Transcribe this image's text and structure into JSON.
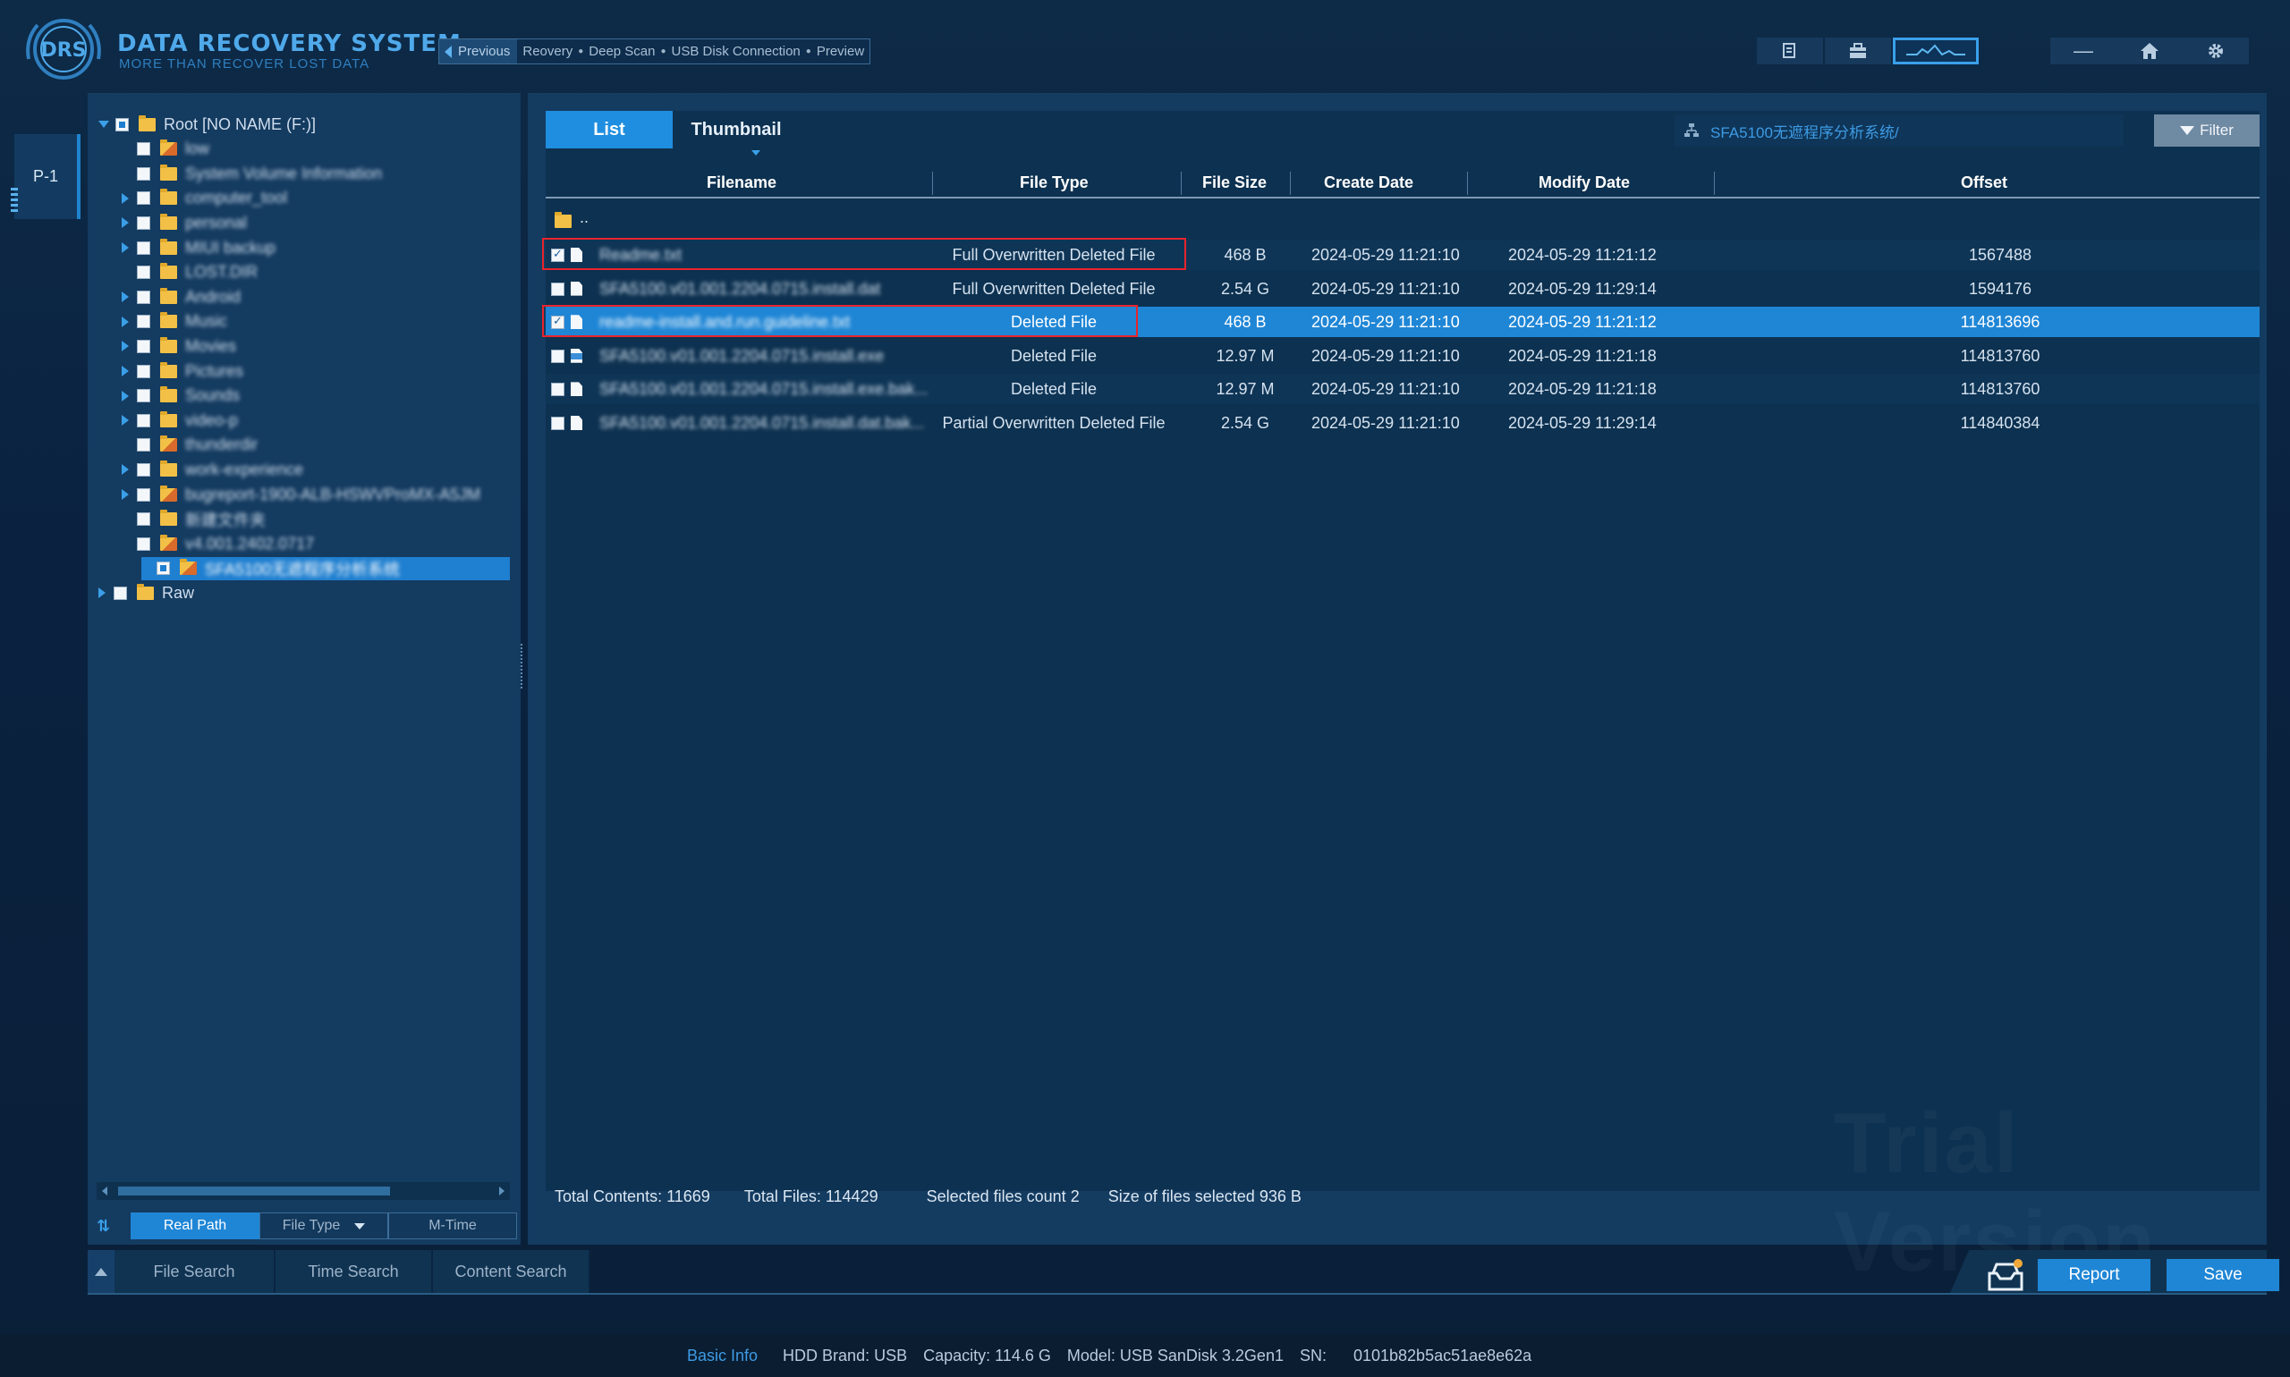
{
  "app": {
    "logo_mark": "DRS",
    "title": "DATA RECOVERY SYSTEM",
    "subtitle": "MORE THAN RECOVER LOST DATA"
  },
  "breadcrumb": {
    "previous_label": "Previous",
    "steps": [
      "Reovery",
      "Deep Scan",
      "USB Disk Connection",
      "Preview"
    ],
    "separator": "●"
  },
  "header_tools": {
    "icons": [
      "report-doc-icon",
      "briefcase-icon",
      "waveform-icon",
      "minimize-icon",
      "home-icon",
      "settings-gear-icon"
    ],
    "minimize_glyph": "—"
  },
  "partition_tab": {
    "label": "P-1"
  },
  "tree": {
    "items": [
      {
        "label": "Root [NO NAME    (F:)]",
        "level": 0,
        "expand": "open",
        "check": "partial",
        "blur": false,
        "special": false
      },
      {
        "label": "low",
        "level": 1,
        "expand": "none",
        "check": "none",
        "blur": true,
        "special": true
      },
      {
        "label": "System Volume Information",
        "level": 1,
        "expand": "none",
        "check": "none",
        "blur": true,
        "special": false
      },
      {
        "label": "computer_tool",
        "level": 1,
        "expand": "closed",
        "check": "none",
        "blur": true,
        "special": false
      },
      {
        "label": "personal",
        "level": 1,
        "expand": "closed",
        "check": "none",
        "blur": true,
        "special": false
      },
      {
        "label": "MIUI backup",
        "level": 1,
        "expand": "closed",
        "check": "none",
        "blur": true,
        "special": false
      },
      {
        "label": "LOST.DIR",
        "level": 1,
        "expand": "none",
        "check": "none",
        "blur": true,
        "special": false
      },
      {
        "label": "Android",
        "level": 1,
        "expand": "closed",
        "check": "none",
        "blur": true,
        "special": false
      },
      {
        "label": "Music",
        "level": 1,
        "expand": "closed",
        "check": "none",
        "blur": true,
        "special": false
      },
      {
        "label": "Movies",
        "level": 1,
        "expand": "closed",
        "check": "none",
        "blur": true,
        "special": false
      },
      {
        "label": "Pictures",
        "level": 1,
        "expand": "closed",
        "check": "none",
        "blur": true,
        "special": false
      },
      {
        "label": "Sounds",
        "level": 1,
        "expand": "closed",
        "check": "none",
        "blur": true,
        "special": false
      },
      {
        "label": "video-p",
        "level": 1,
        "expand": "closed",
        "check": "none",
        "blur": true,
        "special": false
      },
      {
        "label": "thunderdir",
        "level": 1,
        "expand": "none",
        "check": "none",
        "blur": true,
        "special": true
      },
      {
        "label": "work-experience",
        "level": 1,
        "expand": "closed",
        "check": "none",
        "blur": true,
        "special": false
      },
      {
        "label": "bugreport-1900-ALB-HSWVProMX-A5JM",
        "level": 1,
        "expand": "closed",
        "check": "none",
        "blur": true,
        "special": true
      },
      {
        "label": "新建文件夹",
        "level": 1,
        "expand": "none",
        "check": "none",
        "blur": true,
        "special": false
      },
      {
        "label": "v4.001.2402.0717",
        "level": 1,
        "expand": "none",
        "check": "none",
        "blur": true,
        "special": true
      },
      {
        "label": "SFA5100无遮程序分析系统",
        "level": 1,
        "expand": "none",
        "check": "partial",
        "blur": true,
        "special": true,
        "selected": true
      },
      {
        "label": "Raw",
        "level": 0,
        "expand": "closed",
        "check": "none",
        "blur": false,
        "special": false
      }
    ]
  },
  "tree_sort": {
    "buttons": [
      "Real Path",
      "File Type",
      "M-Time"
    ],
    "active": "Real Path"
  },
  "main": {
    "tabs": [
      "List",
      "Thumbnail"
    ],
    "active_tab": "List",
    "path": "SFA5100无遮程序分析系统/",
    "filter_label": "Filter",
    "columns": [
      "Filename",
      "File Type",
      "File Size",
      "Create Date",
      "Modify Date",
      "Offset"
    ],
    "parent_dir": "..",
    "rows": [
      {
        "checked": true,
        "highlight": true,
        "selected": false,
        "icon": "file",
        "name": "Readme.txt",
        "type": "Full Overwritten Deleted File",
        "size": "468 B",
        "created": "2024-05-29 11:21:10",
        "modified": "2024-05-29 11:21:12",
        "offset": "1567488"
      },
      {
        "checked": false,
        "highlight": false,
        "selected": false,
        "icon": "file",
        "name": "SFA5100.v01.001.2204.0715.install.dat",
        "type": "Full Overwritten Deleted File",
        "size": "2.54 G",
        "created": "2024-05-29 11:21:10",
        "modified": "2024-05-29 11:29:14",
        "offset": "1594176"
      },
      {
        "checked": true,
        "highlight": true,
        "selected": true,
        "icon": "file",
        "name": "readme-install.and.run.guideline.txt",
        "type": "Deleted File",
        "size": "468 B",
        "created": "2024-05-29 11:21:10",
        "modified": "2024-05-29 11:21:12",
        "offset": "114813696"
      },
      {
        "checked": false,
        "highlight": false,
        "selected": false,
        "icon": "exe",
        "name": "SFA5100.v01.001.2204.0715.install.exe",
        "type": "Deleted File",
        "size": "12.97 M",
        "created": "2024-05-29 11:21:10",
        "modified": "2024-05-29 11:21:18",
        "offset": "114813760"
      },
      {
        "checked": false,
        "highlight": false,
        "selected": false,
        "icon": "file",
        "name": "SFA5100.v01.001.2204.0715.install.exe.bak...",
        "type": "Deleted File",
        "size": "12.97 M",
        "created": "2024-05-29 11:21:10",
        "modified": "2024-05-29 11:21:18",
        "offset": "114813760"
      },
      {
        "checked": false,
        "highlight": false,
        "selected": false,
        "icon": "file",
        "name": "SFA5100.v01.001.2204.0715.install.dat.bak...",
        "type": "Partial Overwritten Deleted File",
        "size": "2.54 G",
        "created": "2024-05-29 11:21:10",
        "modified": "2024-05-29 11:29:14",
        "offset": "114840384"
      }
    ],
    "watermark": "Trial Version"
  },
  "status": {
    "total_contents_label": "Total Contents:",
    "total_contents": "11669",
    "total_files_label": "Total Files:",
    "total_files": "114429",
    "selected_count_label": "Selected files count",
    "selected_count": "2",
    "selected_size_label": "Size of files  selected",
    "selected_size": "936 B"
  },
  "bottom": {
    "search_tabs": [
      "File Search",
      "Time Search",
      "Content Search"
    ],
    "report_label": "Report",
    "save_label": "Save"
  },
  "info": {
    "basic_label": "Basic Info",
    "hdd_brand": "HDD Brand: USB",
    "capacity": "Capacity: 114.6 G",
    "model": "Model: USB SanDisk 3.2Gen1",
    "sn_label": "SN:",
    "sn": "0101b82b5ac51ae8e62a"
  },
  "colors": {
    "accent": "#1f86d6",
    "highlight_box": "#e8242b",
    "panel": "#143b60",
    "list_bg": "#0d3150"
  }
}
